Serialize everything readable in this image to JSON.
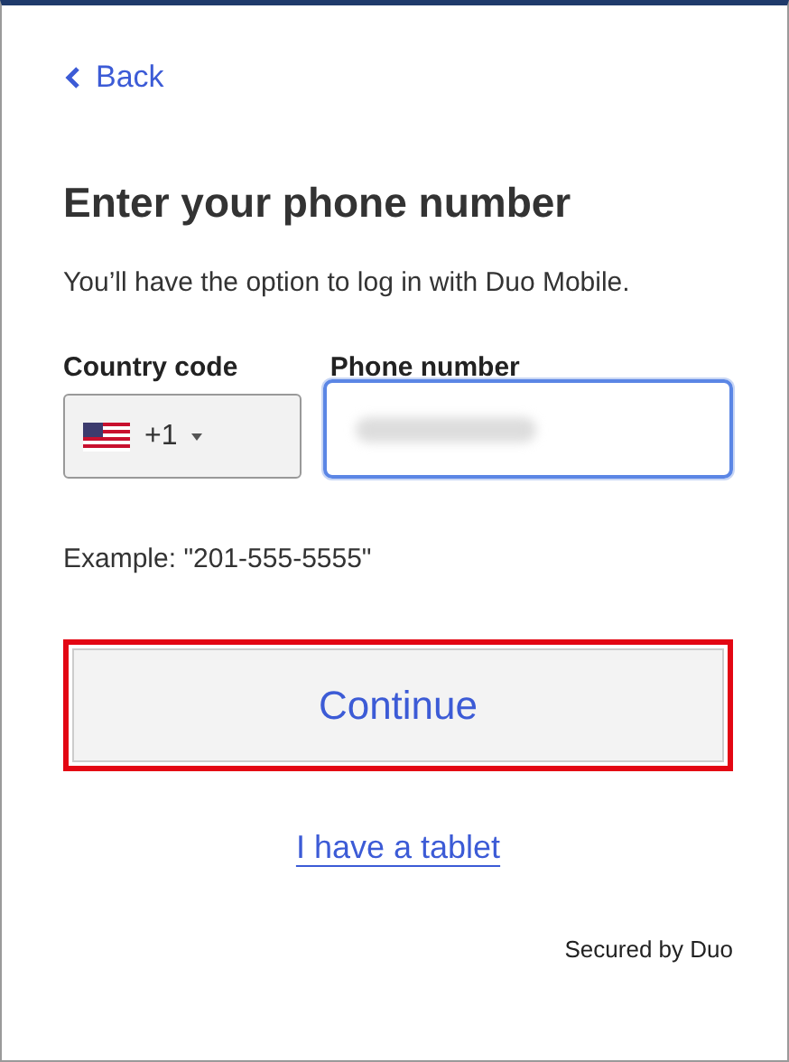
{
  "back_link": {
    "label": "Back"
  },
  "heading": "Enter your phone number",
  "subtitle": "You’ll have the option to log in with Duo Mobile.",
  "country_code": {
    "label": "Country code",
    "value": "+1"
  },
  "phone_number": {
    "label": "Phone number",
    "focused": true,
    "value_redacted": true
  },
  "example": "Example: \"201-555-5555\"",
  "continue_button": {
    "label": "Continue",
    "highlighted": true
  },
  "tablet_link": "I have a tablet",
  "footer": "Secured by Duo"
}
